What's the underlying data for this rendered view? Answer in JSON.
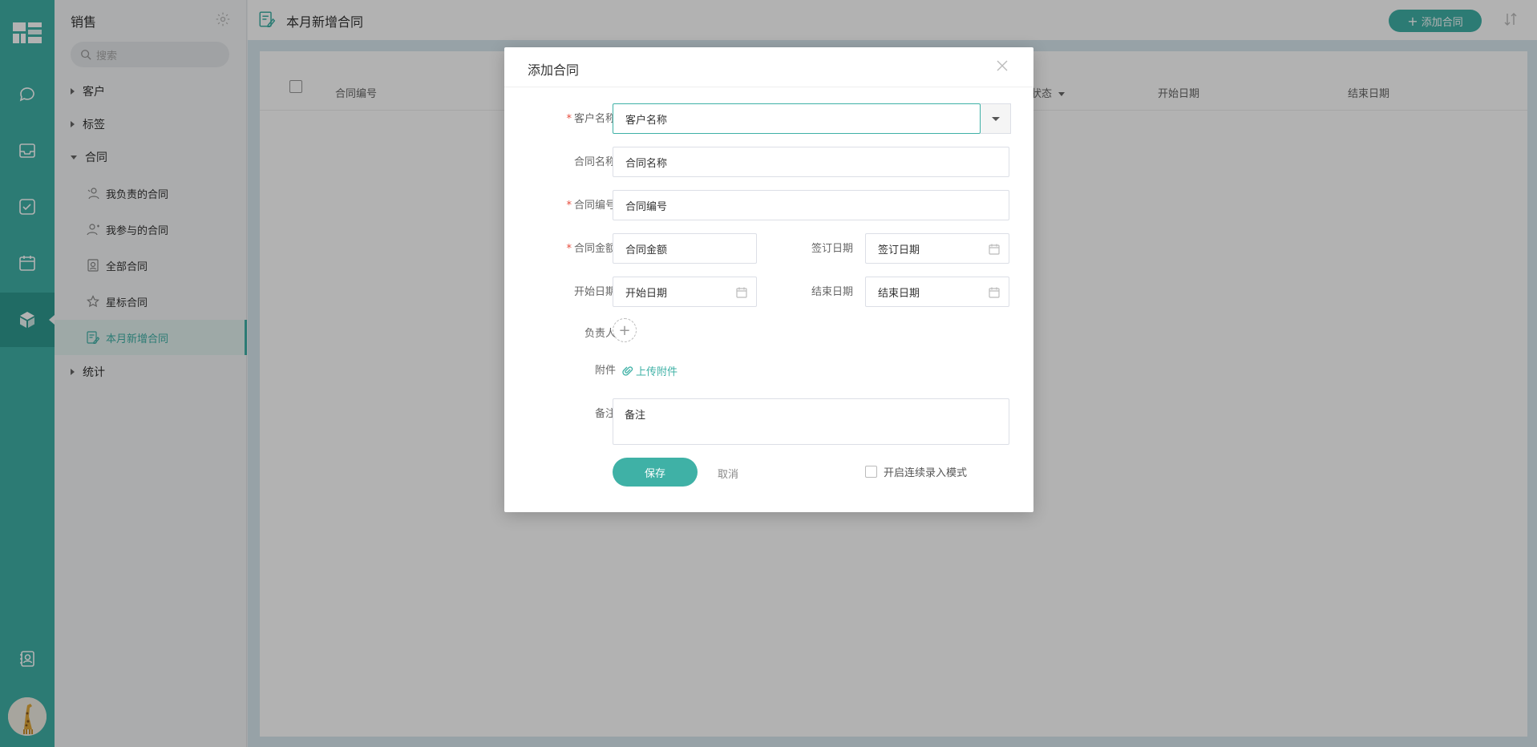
{
  "rail": {
    "items": [
      "chat-icon",
      "inbox-icon",
      "task-icon",
      "calendar-icon",
      "crm-cube-icon",
      "contacts-icon"
    ],
    "active": "crm-cube-icon"
  },
  "sidebar": {
    "title": "销售",
    "search_placeholder": "搜索",
    "nodes": {
      "customer": "客户",
      "tags": "标签",
      "contract": "合同",
      "stats": "统计"
    },
    "contract_items": [
      {
        "label": "我负责的合同",
        "icon": "user-owner-icon"
      },
      {
        "label": "我参与的合同",
        "icon": "user-participant-icon"
      },
      {
        "label": "全部合同",
        "icon": "document-icon"
      },
      {
        "label": "星标合同",
        "icon": "star-icon"
      },
      {
        "label": "本月新增合同",
        "icon": "contract-edit-icon",
        "active": true
      }
    ]
  },
  "header": {
    "title": "本月新增合同",
    "add_button": "添加合同"
  },
  "table": {
    "columns": [
      "合同编号",
      "状态",
      "开始日期",
      "结束日期"
    ]
  },
  "dialog": {
    "title": "添加合同",
    "fields": {
      "customer_name": {
        "label": "客户名称",
        "placeholder": "客户名称",
        "required": true
      },
      "contract_name": {
        "label": "合同名称",
        "placeholder": "合同名称",
        "required": false
      },
      "contract_no": {
        "label": "合同编号",
        "placeholder": "合同编号",
        "required": true
      },
      "amount": {
        "label": "合同金额",
        "placeholder": "合同金额",
        "required": true
      },
      "sign_date": {
        "label": "签订日期",
        "placeholder": "签订日期"
      },
      "start_date": {
        "label": "开始日期",
        "placeholder": "开始日期"
      },
      "end_date": {
        "label": "结束日期",
        "placeholder": "结束日期"
      },
      "owner": {
        "label": "负责人"
      },
      "attachment": {
        "label": "附件",
        "link": "上传附件"
      },
      "note": {
        "label": "备注",
        "placeholder": "备注"
      }
    },
    "required_mark": "*",
    "save": "保存",
    "cancel": "取消",
    "continuous_mode": "开启连续录入模式"
  },
  "colors": {
    "accent": "#3fb1a6",
    "rail_bg": "#3fb1a6",
    "required": "#e74c3c"
  }
}
